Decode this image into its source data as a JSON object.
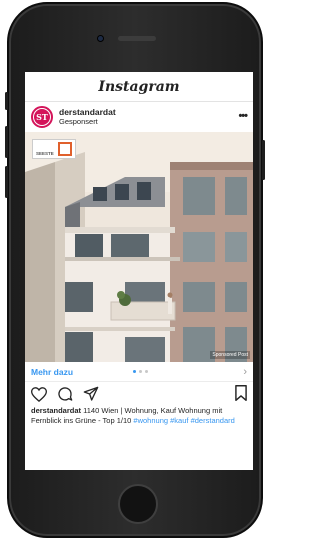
{
  "app": {
    "name": "Instagram"
  },
  "post": {
    "username": "derstandardat",
    "sponsored_label": "Gesponsert",
    "avatar_text": "ST",
    "more_icon": "more-horizontal-icon",
    "image": {
      "logo_text": "SEESTE",
      "overlay_text": "Sponsored Post"
    },
    "cta": {
      "label": "Mehr dazu",
      "chevron": "›",
      "carousel_total": 3,
      "carousel_active": 1
    },
    "actions": [
      "heart-icon",
      "comment-icon",
      "share-icon",
      "bookmark-icon"
    ],
    "caption": {
      "username": "derstandardat",
      "text": "1140 Wien | Wohnung, Kauf Wohnung mit Fernblick ins Grüne - Top 1/10",
      "hashtag_1": "#wohnung",
      "hashtag_2": "#kauf",
      "hashtag_3": "#derstandard"
    }
  },
  "colors": {
    "link": "#3897f0",
    "avatar": "#d4145a",
    "logo_accent": "#e0602c"
  }
}
